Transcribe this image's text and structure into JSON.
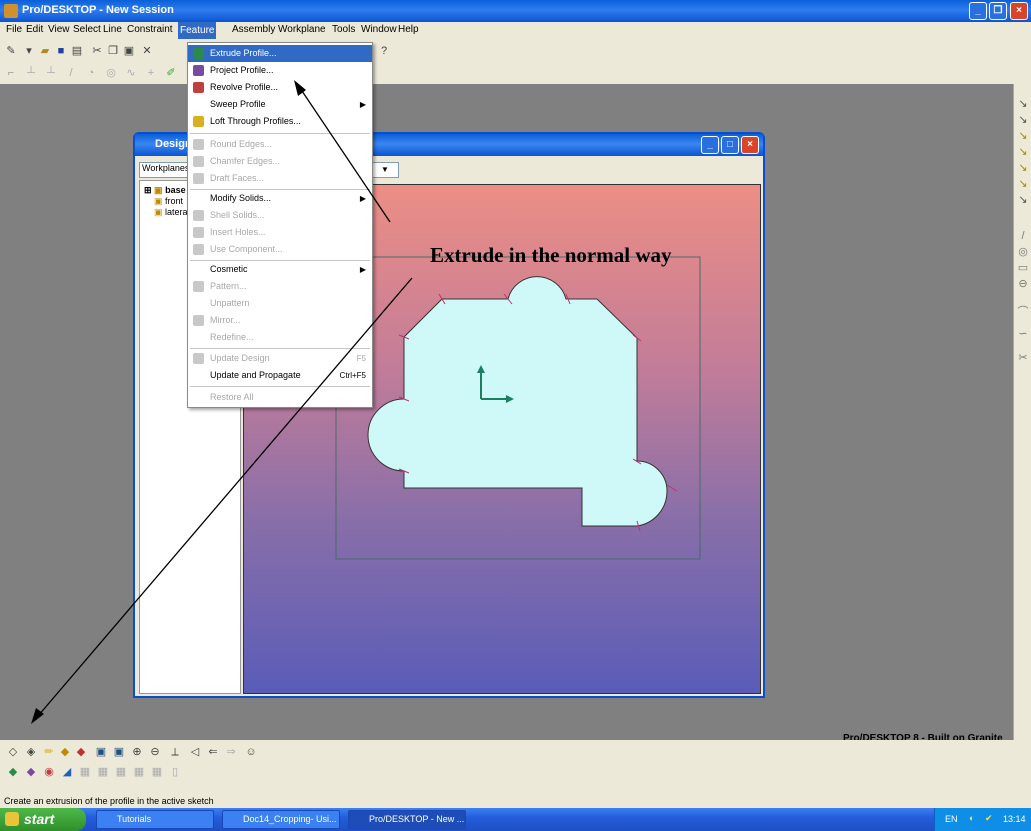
{
  "app": {
    "title": "Pro/DESKTOP - New Session"
  },
  "menubar": {
    "items": [
      "File",
      "Edit",
      "View",
      "Select",
      "Line",
      "Constraint",
      "Feature",
      "Assembly",
      "Workplane",
      "Tools",
      "Window",
      "Help"
    ],
    "active": "Feature"
  },
  "feature_menu": {
    "items": [
      {
        "label": "Extrude Profile...",
        "enabled": true,
        "highlighted": true,
        "icon": "extrude-icon"
      },
      {
        "label": "Project Profile...",
        "enabled": true,
        "icon": "project-icon"
      },
      {
        "label": "Revolve Profile...",
        "enabled": true,
        "icon": "revolve-icon"
      },
      {
        "label": "Sweep Profile",
        "enabled": true,
        "submenu": true
      },
      {
        "label": "Loft Through Profiles...",
        "enabled": true,
        "icon": "loft-icon"
      },
      {
        "label": "Round Edges...",
        "enabled": false,
        "icon": "round-icon"
      },
      {
        "label": "Chamfer Edges...",
        "enabled": false,
        "icon": "chamfer-icon"
      },
      {
        "label": "Draft Faces...",
        "enabled": false,
        "icon": "draft-icon"
      },
      {
        "label": "Modify Solids...",
        "enabled": true,
        "submenu": true
      },
      {
        "label": "Shell Solids...",
        "enabled": false,
        "icon": "shell-icon"
      },
      {
        "label": "Insert Holes...",
        "enabled": false,
        "icon": "hole-icon"
      },
      {
        "label": "Use Component...",
        "enabled": false,
        "icon": "component-icon"
      },
      {
        "label": "Cosmetic",
        "enabled": true,
        "submenu": true
      },
      {
        "label": "Pattern...",
        "enabled": false,
        "icon": "pattern-icon"
      },
      {
        "label": "Unpattern",
        "enabled": false
      },
      {
        "label": "Mirror...",
        "enabled": false,
        "icon": "mirror-icon"
      },
      {
        "label": "Redefine...",
        "enabled": false
      },
      {
        "label": "Update Design",
        "enabled": false,
        "shortcut": "F5",
        "icon": "update-icon"
      },
      {
        "label": "Update and Propagate",
        "enabled": true,
        "shortcut": "Ctrl+F5"
      },
      {
        "label": "Restore All",
        "enabled": false
      }
    ]
  },
  "design_window": {
    "title": "Design",
    "combo_value": "Workplanes",
    "tree": [
      "base",
      "front",
      "lateral"
    ]
  },
  "annotation": "Extrude in the normal way",
  "branding": "Pro/DESKTOP 8 - Built on Granite",
  "status_text": "Create an extrusion of the profile in the active sketch",
  "taskbar": {
    "start": "start",
    "tasks": [
      "Tutorials",
      "Doc14_Cropping- Usi...",
      "Pro/DESKTOP - New ..."
    ],
    "tray_lang": "EN",
    "clock": "13:14"
  },
  "colors": {
    "accent": "#316ac5",
    "titlebar": "#0a5fd8",
    "profile_fill": "#cff8f8"
  }
}
